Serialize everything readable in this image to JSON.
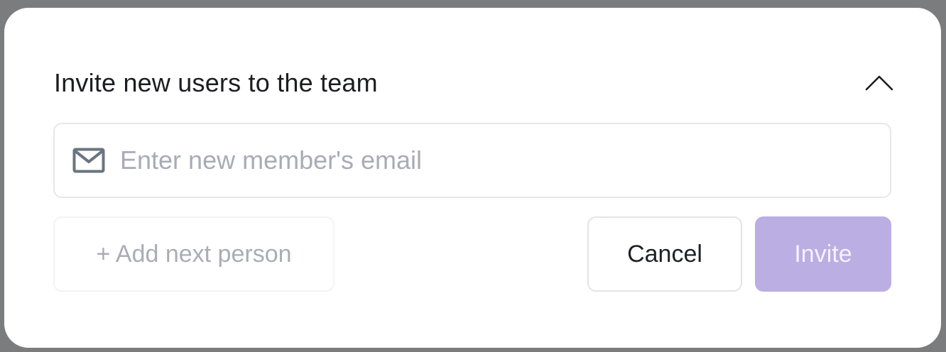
{
  "dialog": {
    "title": "Invite new users to the team",
    "collapse_icon": "chevron-up-icon"
  },
  "email_field": {
    "icon": "mail-icon",
    "value": "",
    "placeholder": "Enter new member's email"
  },
  "actions": {
    "add_person_label": "+ Add next person",
    "cancel_label": "Cancel",
    "invite_label": "Invite"
  },
  "colors": {
    "invite_button_bg": "#bbaee3",
    "backdrop": "#7a7c7e",
    "placeholder_text": "#a7acb5",
    "icon": "#6b7480"
  }
}
